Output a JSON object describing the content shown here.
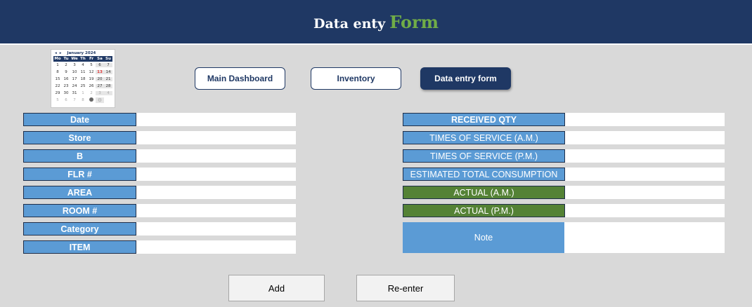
{
  "header": {
    "title": "Data enty",
    "accent": "Form"
  },
  "calendar": {
    "month_label": "January 2024",
    "prev": "◂",
    "next": "▸",
    "weekdays": [
      "Mo",
      "Tu",
      "We",
      "Th",
      "Fr",
      "Sa",
      "Su"
    ],
    "weeks": [
      [
        "1",
        "2",
        "3",
        "4",
        "5",
        "6",
        "7"
      ],
      [
        "8",
        "9",
        "10",
        "11",
        "12",
        "13",
        "14"
      ],
      [
        "15",
        "16",
        "17",
        "18",
        "19",
        "20",
        "21"
      ],
      [
        "22",
        "23",
        "24",
        "25",
        "26",
        "27",
        "28"
      ],
      [
        "29",
        "30",
        "31",
        "1",
        "2",
        "3",
        "4"
      ],
      [
        "5",
        "6",
        "7",
        "8",
        "",
        "",
        ""
      ]
    ],
    "today": "13"
  },
  "nav": {
    "main_dashboard": "Main Dashboard",
    "inventory": "Inventory",
    "data_entry_form": "Data entry form"
  },
  "left_fields": [
    {
      "label": "Date",
      "value": ""
    },
    {
      "label": "Store",
      "value": ""
    },
    {
      "label": "B",
      "value": ""
    },
    {
      "label": "FLR #",
      "value": ""
    },
    {
      "label": "AREA",
      "value": ""
    },
    {
      "label": "ROOM #",
      "value": ""
    },
    {
      "label": "Category",
      "value": ""
    },
    {
      "label": "ITEM",
      "value": ""
    }
  ],
  "right_fields": [
    {
      "label": "RECEIVED QTY",
      "value": ""
    },
    {
      "label": "TIMES OF SERVICE (A.M.)",
      "value": ""
    },
    {
      "label": "TIMES OF SERVICE (P.M.)",
      "value": ""
    },
    {
      "label": "ESTIMATED TOTAL CONSUMPTION",
      "value": ""
    },
    {
      "label": "ACTUAL (A.M.)",
      "value": ""
    },
    {
      "label": "ACTUAL (P.M.)",
      "value": ""
    }
  ],
  "note": {
    "label": "Note",
    "value": ""
  },
  "actions": {
    "add": "Add",
    "reenter": "Re-enter"
  },
  "colors": {
    "header_bg": "#1f3864",
    "accent": "#70ad47",
    "label_blue": "#5b9bd5",
    "label_green": "#548235"
  }
}
